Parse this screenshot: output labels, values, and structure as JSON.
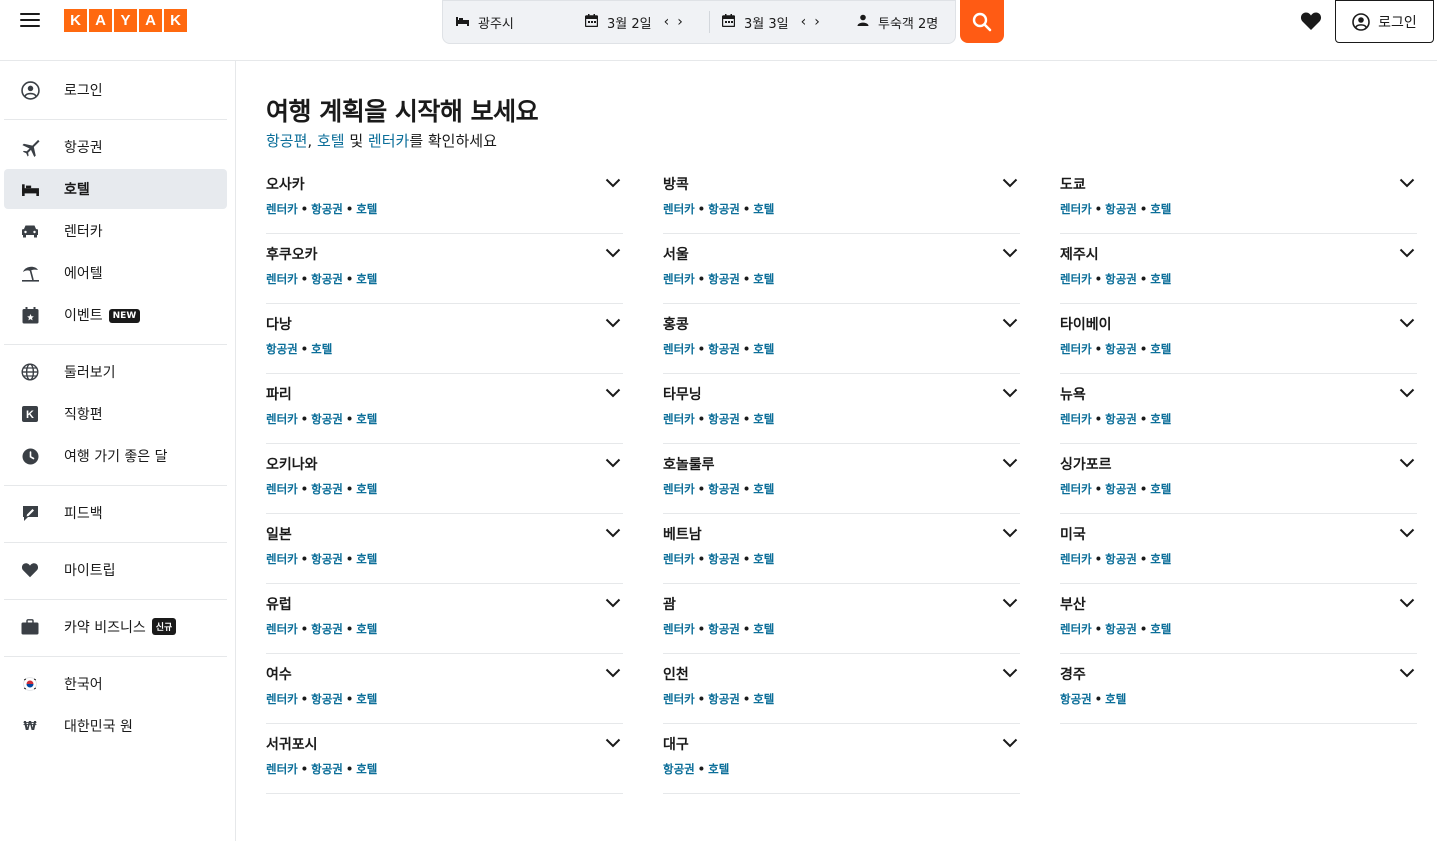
{
  "brand": {
    "letters": [
      "K",
      "A",
      "Y",
      "A",
      "K"
    ],
    "color": "#ff690f"
  },
  "search": {
    "location": "광주시",
    "checkin": "3월 2일",
    "checkout": "3월 3일",
    "guests": "투숙객 2명",
    "button_color": "#ff5b14"
  },
  "header": {
    "login_label": "로그인"
  },
  "sidebar": {
    "items": [
      {
        "label": "로그인",
        "icon": "user-circle-icon"
      },
      {
        "label": "항공권",
        "icon": "plane-icon"
      },
      {
        "label": "호텔",
        "icon": "bed-icon",
        "active": true
      },
      {
        "label": "렌터카",
        "icon": "car-icon"
      },
      {
        "label": "에어텔",
        "icon": "beach-umbrella-icon"
      },
      {
        "label": "이벤트",
        "icon": "calendar-star-icon",
        "badge": "NEW"
      },
      {
        "label": "둘러보기",
        "icon": "globe-icon"
      },
      {
        "label": "직항편",
        "icon": "k-square-icon"
      },
      {
        "label": "여행 가기 좋은 달",
        "icon": "clock-icon"
      },
      {
        "label": "피드백",
        "icon": "feedback-icon"
      },
      {
        "label": "마이트립",
        "icon": "heart-icon"
      },
      {
        "label": "카약 비즈니스",
        "icon": "briefcase-icon",
        "badge": "신규"
      },
      {
        "label": "한국어",
        "icon": "korea-flag-icon"
      },
      {
        "label": "대한민국 원",
        "icon": "won-icon"
      }
    ]
  },
  "main": {
    "title": "여행 계획을 시작해 보세요",
    "subtitle": {
      "flights": "항공편",
      "comma": ", ",
      "hotels": "호텔",
      "and": " 및 ",
      "cars": "렌터카",
      "rest": "를 확인하세요"
    },
    "link_labels": {
      "car": "렌터카",
      "flight": "항공권",
      "hotel": "호텔"
    },
    "columns": [
      [
        {
          "name": "오사카",
          "links": [
            "렌터카",
            "항공권",
            "호텔"
          ]
        },
        {
          "name": "후쿠오카",
          "links": [
            "렌터카",
            "항공권",
            "호텔"
          ]
        },
        {
          "name": "다낭",
          "links": [
            "항공권",
            "호텔"
          ]
        },
        {
          "name": "파리",
          "links": [
            "렌터카",
            "항공권",
            "호텔"
          ]
        },
        {
          "name": "오키나와",
          "links": [
            "렌터카",
            "항공권",
            "호텔"
          ]
        },
        {
          "name": "일본",
          "links": [
            "렌터카",
            "항공권",
            "호텔"
          ]
        },
        {
          "name": "유럽",
          "links": [
            "렌터카",
            "항공권",
            "호텔"
          ]
        },
        {
          "name": "여수",
          "links": [
            "렌터카",
            "항공권",
            "호텔"
          ]
        },
        {
          "name": "서귀포시",
          "links": [
            "렌터카",
            "항공권",
            "호텔"
          ]
        }
      ],
      [
        {
          "name": "방콕",
          "links": [
            "렌터카",
            "항공권",
            "호텔"
          ]
        },
        {
          "name": "서울",
          "links": [
            "렌터카",
            "항공권",
            "호텔"
          ]
        },
        {
          "name": "홍콩",
          "links": [
            "렌터카",
            "항공권",
            "호텔"
          ]
        },
        {
          "name": "타무닝",
          "links": [
            "렌터카",
            "항공권",
            "호텔"
          ]
        },
        {
          "name": "호놀룰루",
          "links": [
            "렌터카",
            "항공권",
            "호텔"
          ]
        },
        {
          "name": "베트남",
          "links": [
            "렌터카",
            "항공권",
            "호텔"
          ]
        },
        {
          "name": "괌",
          "links": [
            "렌터카",
            "항공권",
            "호텔"
          ]
        },
        {
          "name": "인천",
          "links": [
            "렌터카",
            "항공권",
            "호텔"
          ]
        },
        {
          "name": "대구",
          "links": [
            "항공권",
            "호텔"
          ]
        }
      ],
      [
        {
          "name": "도쿄",
          "links": [
            "렌터카",
            "항공권",
            "호텔"
          ]
        },
        {
          "name": "제주시",
          "links": [
            "렌터카",
            "항공권",
            "호텔"
          ]
        },
        {
          "name": "타이베이",
          "links": [
            "렌터카",
            "항공권",
            "호텔"
          ]
        },
        {
          "name": "뉴욕",
          "links": [
            "렌터카",
            "항공권",
            "호텔"
          ]
        },
        {
          "name": "싱가포르",
          "links": [
            "렌터카",
            "항공권",
            "호텔"
          ]
        },
        {
          "name": "미국",
          "links": [
            "렌터카",
            "항공권",
            "호텔"
          ]
        },
        {
          "name": "부산",
          "links": [
            "렌터카",
            "항공권",
            "호텔"
          ]
        },
        {
          "name": "경주",
          "links": [
            "항공권",
            "호텔"
          ]
        }
      ]
    ]
  }
}
